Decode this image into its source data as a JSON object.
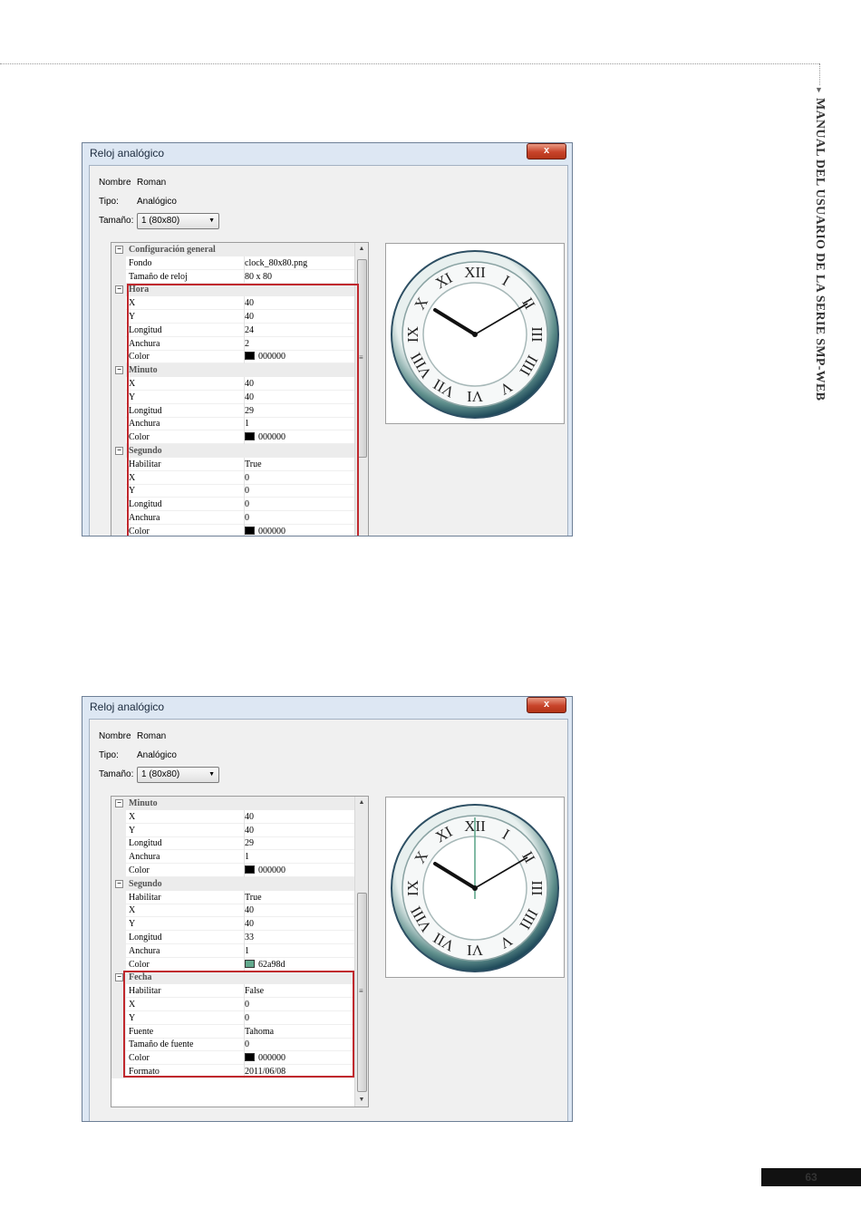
{
  "page": {
    "side_title": "MANUAL DEL USUARIO DE LA SERIE SMP-WEB",
    "page_number": "63"
  },
  "dialog1": {
    "title": "Reloj analógico",
    "close_label": "x",
    "nombre_label": "Nombre",
    "nombre_value": "Roman",
    "tipo_label": "Tipo:",
    "tipo_value": "Analógico",
    "tamano_label": "Tamaño:",
    "tamano_value": "1  (80x80)",
    "grid_rows": [
      {
        "kind": "cat",
        "name": "Configuración general"
      },
      {
        "kind": "prop",
        "name": "Fondo",
        "value": "clock_80x80.png"
      },
      {
        "kind": "prop",
        "name": "Tamaño de reloj",
        "value": "80 x 80"
      },
      {
        "kind": "cat",
        "name": "Hora"
      },
      {
        "kind": "prop",
        "name": "X",
        "value": "40"
      },
      {
        "kind": "prop",
        "name": "Y",
        "value": "40"
      },
      {
        "kind": "prop",
        "name": "Longitud",
        "value": "24"
      },
      {
        "kind": "prop",
        "name": "Anchura",
        "value": "2"
      },
      {
        "kind": "prop",
        "name": "Color",
        "value": "000000",
        "swatch": "#000000"
      },
      {
        "kind": "cat",
        "name": "Minuto"
      },
      {
        "kind": "prop",
        "name": "X",
        "value": "40"
      },
      {
        "kind": "prop",
        "name": "Y",
        "value": "40"
      },
      {
        "kind": "prop",
        "name": "Longitud",
        "value": "29"
      },
      {
        "kind": "prop",
        "name": "Anchura",
        "value": "1"
      },
      {
        "kind": "prop",
        "name": "Color",
        "value": "000000",
        "swatch": "#000000"
      },
      {
        "kind": "cat",
        "name": "Segundo"
      },
      {
        "kind": "prop",
        "name": "Habilitar",
        "value": "True"
      },
      {
        "kind": "prop",
        "name": "X",
        "value": "0"
      },
      {
        "kind": "prop",
        "name": "Y",
        "value": "0"
      },
      {
        "kind": "prop",
        "name": "Longitud",
        "value": "0"
      },
      {
        "kind": "prop",
        "name": "Anchura",
        "value": "0"
      },
      {
        "kind": "prop",
        "name": "Color",
        "value": "000000",
        "swatch": "#000000"
      }
    ],
    "show_second_hand": false
  },
  "dialog2": {
    "title": "Reloj analógico",
    "close_label": "x",
    "nombre_label": "Nombre",
    "nombre_value": "Roman",
    "tipo_label": "Tipo:",
    "tipo_value": "Analógico",
    "tamano_label": "Tamaño:",
    "tamano_value": "1  (80x80)",
    "grid_rows": [
      {
        "kind": "cat",
        "name": "Minuto"
      },
      {
        "kind": "prop",
        "name": "X",
        "value": "40"
      },
      {
        "kind": "prop",
        "name": "Y",
        "value": "40"
      },
      {
        "kind": "prop",
        "name": "Longitud",
        "value": "29"
      },
      {
        "kind": "prop",
        "name": "Anchura",
        "value": "1"
      },
      {
        "kind": "prop",
        "name": "Color",
        "value": "000000",
        "swatch": "#000000"
      },
      {
        "kind": "cat",
        "name": "Segundo"
      },
      {
        "kind": "prop",
        "name": "Habilitar",
        "value": "True"
      },
      {
        "kind": "prop",
        "name": "X",
        "value": "40"
      },
      {
        "kind": "prop",
        "name": "Y",
        "value": "40"
      },
      {
        "kind": "prop",
        "name": "Longitud",
        "value": "33"
      },
      {
        "kind": "prop",
        "name": "Anchura",
        "value": "1"
      },
      {
        "kind": "prop",
        "name": "Color",
        "value": "62a98d",
        "swatch": "#62a98d"
      },
      {
        "kind": "cat",
        "name": "Fecha"
      },
      {
        "kind": "prop",
        "name": "Habilitar",
        "value": "False"
      },
      {
        "kind": "prop",
        "name": "X",
        "value": "0"
      },
      {
        "kind": "prop",
        "name": "Y",
        "value": "0"
      },
      {
        "kind": "prop",
        "name": "Fuente",
        "value": "Tahoma"
      },
      {
        "kind": "prop",
        "name": "Tamaño de fuente",
        "value": "0"
      },
      {
        "kind": "prop",
        "name": "Color",
        "value": "000000",
        "swatch": "#000000"
      },
      {
        "kind": "prop",
        "name": "Formato",
        "value": "2011/06/08"
      }
    ],
    "show_second_hand": true,
    "second_hand_color": "#62a98d"
  },
  "roman_numerals": [
    "XII",
    "I",
    "II",
    "III",
    "IIII",
    "V",
    "VI",
    "VII",
    "VIII",
    "IX",
    "X",
    "XI"
  ]
}
